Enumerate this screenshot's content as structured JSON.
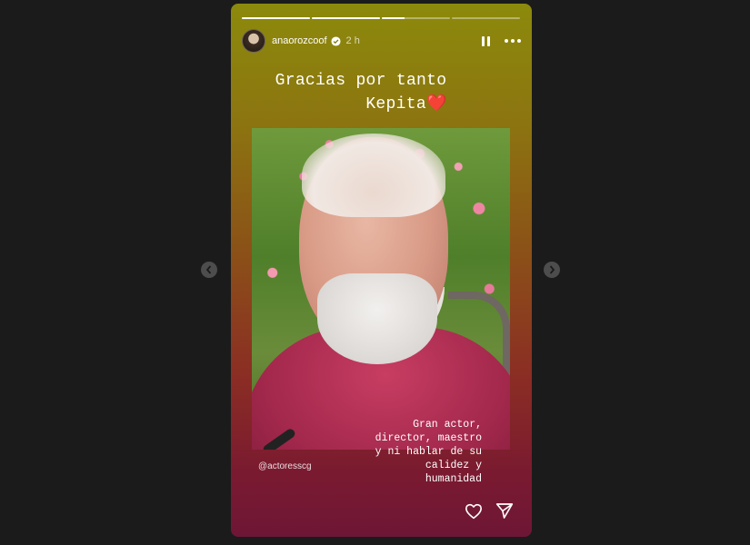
{
  "story": {
    "progress": [
      1,
      1,
      0.33,
      0
    ],
    "username": "anaorozcoof",
    "time": "2 h",
    "caption_line1": "Gracias por tanto",
    "caption_line2": "Kepita❤️",
    "body_text": "Gran actor,\ndirector, maestro\ny ni hablar de su\ncalidez y\nhumanidad",
    "mention": "@actoresscg"
  },
  "icons": {
    "avatar": "profile-avatar",
    "verified": "verified-badge-icon",
    "pause": "pause-icon",
    "more": "more-options-icon",
    "like": "heart-icon",
    "share": "send-icon",
    "prev": "chevron-left-icon",
    "next": "chevron-right-icon"
  },
  "colors": {
    "page_bg": "#1b1b1b",
    "gradient_top": "#8c8a0c",
    "gradient_bottom": "#6e1636"
  }
}
